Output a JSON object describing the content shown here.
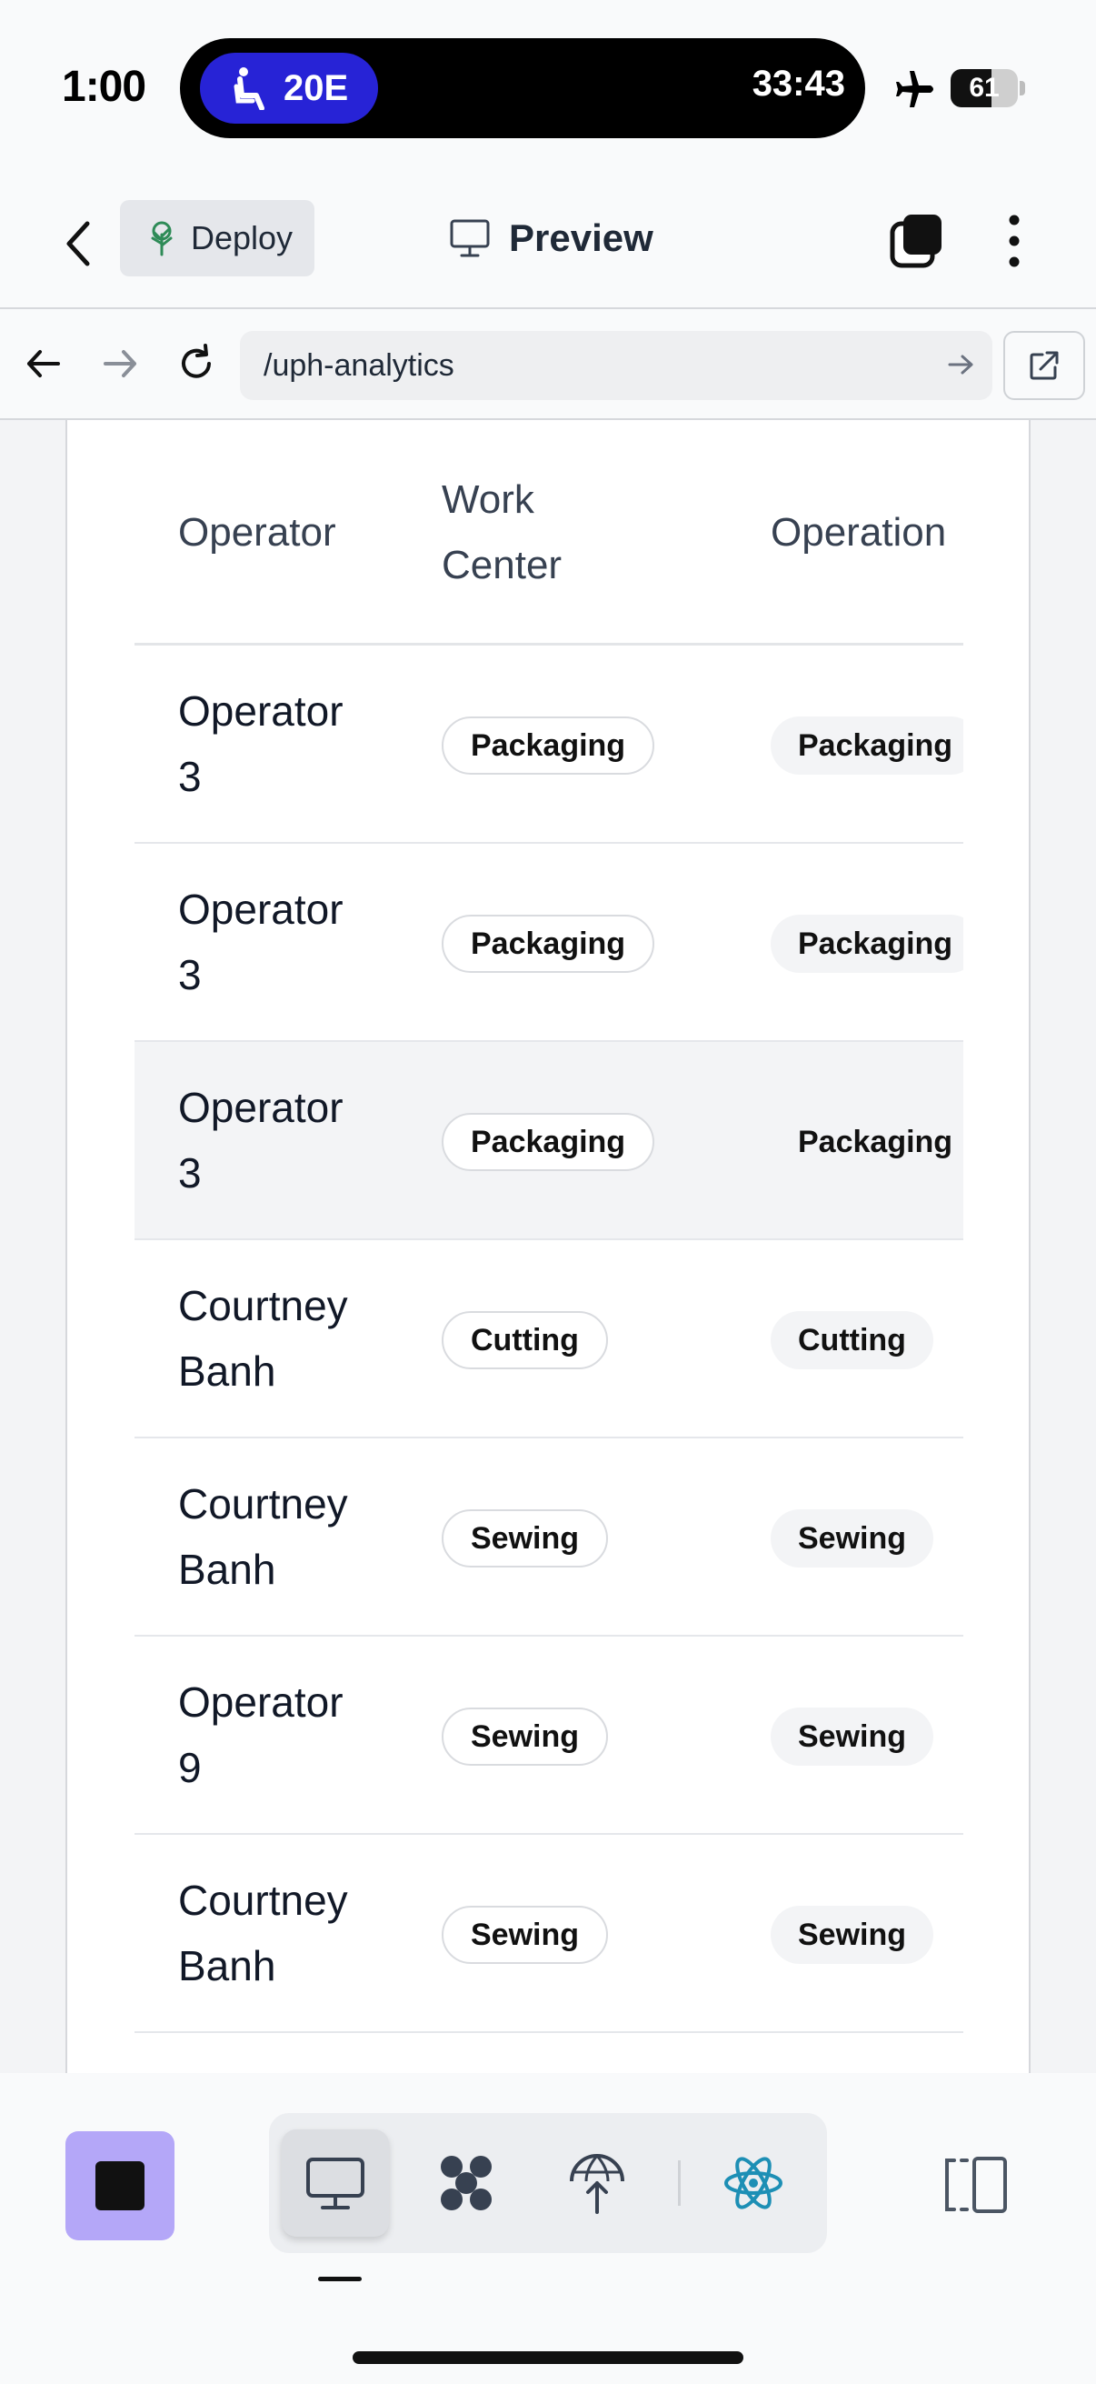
{
  "status_bar": {
    "time": "1:00",
    "seat": "20E",
    "timer": "33:43",
    "battery": "61",
    "battery_level": 0.61
  },
  "toolbar": {
    "deploy_label": "Deploy",
    "preview_label": "Preview"
  },
  "browser": {
    "url": "/uph-analytics"
  },
  "table": {
    "headers": {
      "operator": "Operator",
      "work_center_line1": "Work",
      "work_center_line2": "Center",
      "operation": "Operation"
    },
    "rows": [
      {
        "op1": "Operator",
        "op2": "3",
        "work_center": "Packaging",
        "operation": "Packaging"
      },
      {
        "op1": "Operator",
        "op2": "3",
        "work_center": "Packaging",
        "operation": "Packaging"
      },
      {
        "op1": "Operator",
        "op2": "3",
        "work_center": "Packaging",
        "operation": "Packaging"
      },
      {
        "op1": "Courtney",
        "op2": "Banh",
        "work_center": "Cutting",
        "operation": "Cutting"
      },
      {
        "op1": "Courtney",
        "op2": "Banh",
        "work_center": "Sewing",
        "operation": "Sewing"
      },
      {
        "op1": "Operator",
        "op2": "9",
        "work_center": "Sewing",
        "operation": "Sewing"
      },
      {
        "op1": "Courtney",
        "op2": "Banh",
        "work_center": "Sewing",
        "operation": "Sewing"
      }
    ]
  },
  "colors": {
    "seat_pill": "#2723d6",
    "stop_button": "#b4a7f8",
    "react_icon": "#1d8fb5",
    "deploy_icon": "#2e8b57"
  }
}
